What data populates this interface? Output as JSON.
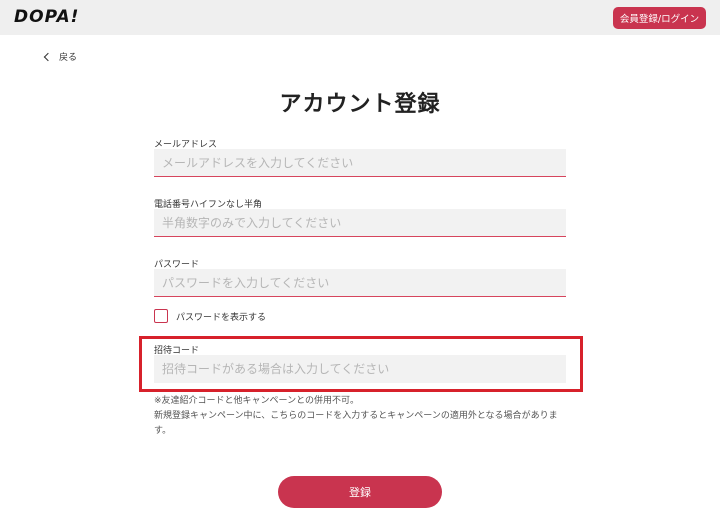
{
  "header": {
    "logo_text": "DOPA!",
    "login_button": "会員登録/ログイン"
  },
  "nav": {
    "back_label": "戻る"
  },
  "page": {
    "title": "アカウント登録"
  },
  "form": {
    "email": {
      "label": "メールアドレス",
      "placeholder": "メールアドレスを入力してください",
      "value": ""
    },
    "phone": {
      "label": "電話番号ハイフンなし半角",
      "placeholder": "半角数字のみで入力してください",
      "value": ""
    },
    "password": {
      "label": "パスワード",
      "placeholder": "パスワードを入力してください",
      "value": ""
    },
    "show_password": {
      "label": "パスワードを表示する",
      "checked": false
    },
    "invite": {
      "label": "招待コード",
      "placeholder": "招待コードがある場合は入力してください",
      "value": ""
    },
    "note_1": "※友達紹介コードと他キャンペーンとの併用不可。",
    "note_2": "新規登録キャンペーン中に、こちらのコードを入力するとキャンペーンの適用外となる場合があります。",
    "submit_label": "登録"
  },
  "colors": {
    "accent": "#c9344f",
    "highlight": "#d7212b",
    "header_bg": "#efefef"
  }
}
